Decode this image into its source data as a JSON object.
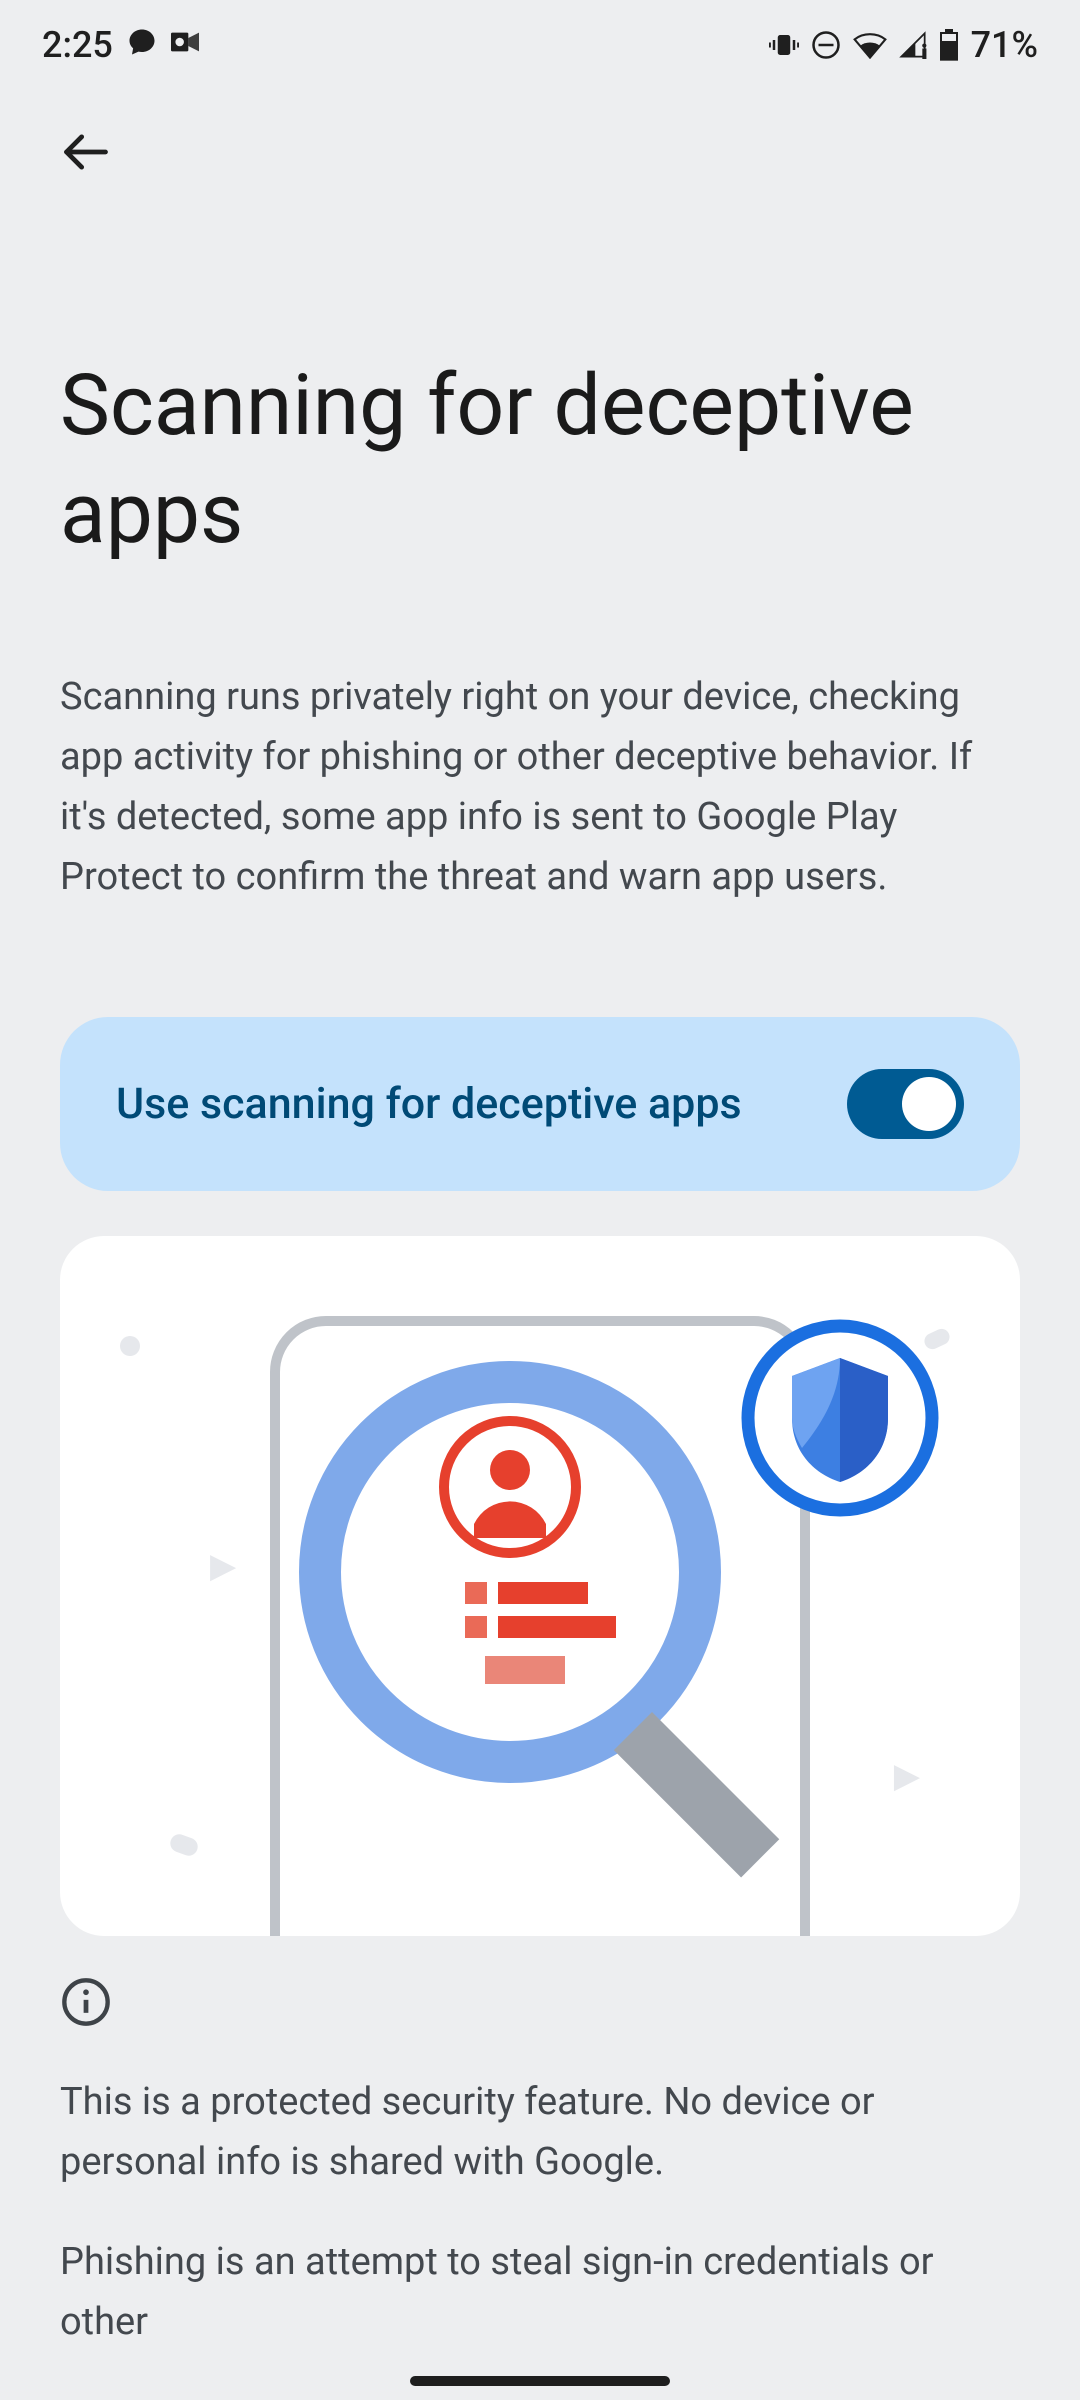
{
  "status": {
    "time": "2:25",
    "battery_label": "71%"
  },
  "header": {
    "title": "Scanning for deceptive apps"
  },
  "description": "Scanning runs privately right on your device, checking app activity for phishing or other deceptive behavior. If it's detected, some app info is sent to Google Play Protect to confirm the threat and warn app users.",
  "toggle": {
    "label": "Use scanning for deceptive apps",
    "on": true
  },
  "footer": {
    "text1": "This is a protected security feature. No device or personal info is shared with Google.",
    "text2": "Phishing is an attempt to steal sign-in credentials or other"
  }
}
